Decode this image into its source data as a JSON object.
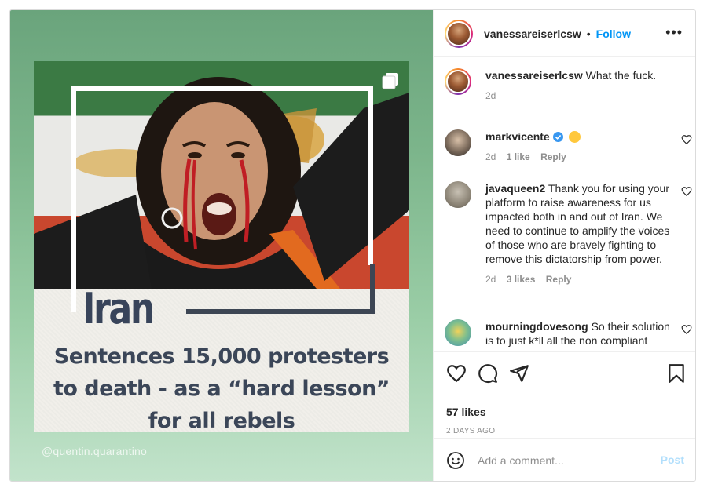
{
  "post": {
    "headline_tag": "Iran",
    "headline_lines": [
      "Sentences 15,000 protesters",
      "to death - as a “hard lesson”",
      "for all rebels"
    ],
    "watermark": "@quentin.quarantino"
  },
  "header": {
    "username": "vanessareiserlcsw",
    "separator": "•",
    "follow_label": "Follow",
    "more_label": "•••"
  },
  "comments": [
    {
      "username": "vanessareiserlcsw",
      "text": "What the fuck.",
      "time": "2d",
      "likes": "",
      "reply": ""
    },
    {
      "username": "markvicente",
      "text": "",
      "time": "2d",
      "likes": "1 like",
      "reply": "Reply"
    },
    {
      "username": "javaqueen2",
      "text": "Thank you for using your platform to raise awareness for us impacted both in and out of Iran. We need to continue to amplify the voices of those who are bravely fighting to remove this dictatorship from power.",
      "time": "2d",
      "likes": "3 likes",
      "reply": "Reply"
    },
    {
      "username": "mourningdovesong",
      "text": "So their solution is to just k*ll all the non compliant women? So it's a witch",
      "time": "",
      "likes": "",
      "reply": ""
    }
  ],
  "actions": {
    "likes": "57 likes",
    "time_ago": "2 DAYS AGO"
  },
  "add_comment": {
    "placeholder": "Add a comment...",
    "post_label": "Post"
  },
  "colors": {
    "accent": "#0095f6",
    "post_disabled": "#b2dffc",
    "verified": "#3897f0"
  },
  "icons": [
    "multi-image-icon",
    "more-icon",
    "verified-icon",
    "heart-icon",
    "comment-icon",
    "share-icon",
    "bookmark-icon",
    "emoji-icon"
  ]
}
